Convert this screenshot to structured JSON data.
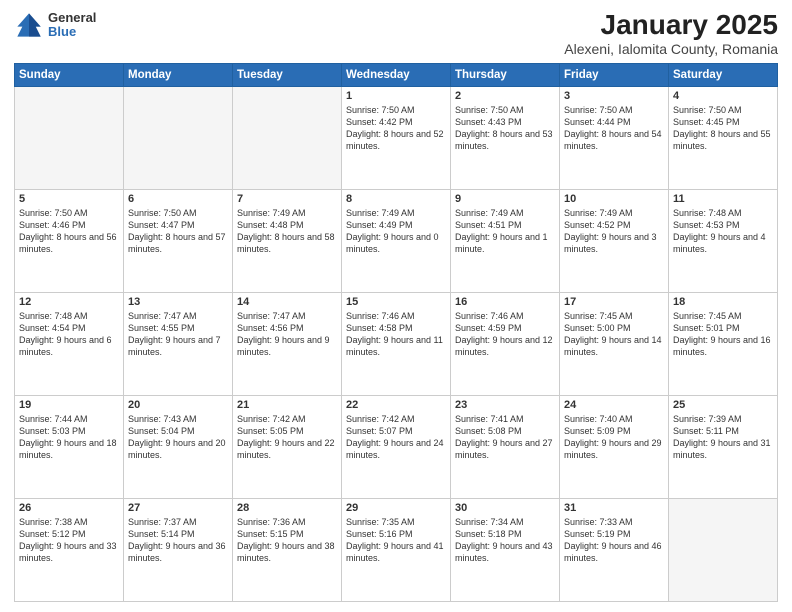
{
  "header": {
    "logo_line1": "General",
    "logo_line2": "Blue",
    "title": "January 2025",
    "subtitle": "Alexeni, Ialomita County, Romania"
  },
  "days_of_week": [
    "Sunday",
    "Monday",
    "Tuesday",
    "Wednesday",
    "Thursday",
    "Friday",
    "Saturday"
  ],
  "weeks": [
    [
      {
        "day": "",
        "info": ""
      },
      {
        "day": "",
        "info": ""
      },
      {
        "day": "",
        "info": ""
      },
      {
        "day": "1",
        "info": "Sunrise: 7:50 AM\nSunset: 4:42 PM\nDaylight: 8 hours\nand 52 minutes."
      },
      {
        "day": "2",
        "info": "Sunrise: 7:50 AM\nSunset: 4:43 PM\nDaylight: 8 hours\nand 53 minutes."
      },
      {
        "day": "3",
        "info": "Sunrise: 7:50 AM\nSunset: 4:44 PM\nDaylight: 8 hours\nand 54 minutes."
      },
      {
        "day": "4",
        "info": "Sunrise: 7:50 AM\nSunset: 4:45 PM\nDaylight: 8 hours\nand 55 minutes."
      }
    ],
    [
      {
        "day": "5",
        "info": "Sunrise: 7:50 AM\nSunset: 4:46 PM\nDaylight: 8 hours\nand 56 minutes."
      },
      {
        "day": "6",
        "info": "Sunrise: 7:50 AM\nSunset: 4:47 PM\nDaylight: 8 hours\nand 57 minutes."
      },
      {
        "day": "7",
        "info": "Sunrise: 7:49 AM\nSunset: 4:48 PM\nDaylight: 8 hours\nand 58 minutes."
      },
      {
        "day": "8",
        "info": "Sunrise: 7:49 AM\nSunset: 4:49 PM\nDaylight: 9 hours\nand 0 minutes."
      },
      {
        "day": "9",
        "info": "Sunrise: 7:49 AM\nSunset: 4:51 PM\nDaylight: 9 hours\nand 1 minute."
      },
      {
        "day": "10",
        "info": "Sunrise: 7:49 AM\nSunset: 4:52 PM\nDaylight: 9 hours\nand 3 minutes."
      },
      {
        "day": "11",
        "info": "Sunrise: 7:48 AM\nSunset: 4:53 PM\nDaylight: 9 hours\nand 4 minutes."
      }
    ],
    [
      {
        "day": "12",
        "info": "Sunrise: 7:48 AM\nSunset: 4:54 PM\nDaylight: 9 hours\nand 6 minutes."
      },
      {
        "day": "13",
        "info": "Sunrise: 7:47 AM\nSunset: 4:55 PM\nDaylight: 9 hours\nand 7 minutes."
      },
      {
        "day": "14",
        "info": "Sunrise: 7:47 AM\nSunset: 4:56 PM\nDaylight: 9 hours\nand 9 minutes."
      },
      {
        "day": "15",
        "info": "Sunrise: 7:46 AM\nSunset: 4:58 PM\nDaylight: 9 hours\nand 11 minutes."
      },
      {
        "day": "16",
        "info": "Sunrise: 7:46 AM\nSunset: 4:59 PM\nDaylight: 9 hours\nand 12 minutes."
      },
      {
        "day": "17",
        "info": "Sunrise: 7:45 AM\nSunset: 5:00 PM\nDaylight: 9 hours\nand 14 minutes."
      },
      {
        "day": "18",
        "info": "Sunrise: 7:45 AM\nSunset: 5:01 PM\nDaylight: 9 hours\nand 16 minutes."
      }
    ],
    [
      {
        "day": "19",
        "info": "Sunrise: 7:44 AM\nSunset: 5:03 PM\nDaylight: 9 hours\nand 18 minutes."
      },
      {
        "day": "20",
        "info": "Sunrise: 7:43 AM\nSunset: 5:04 PM\nDaylight: 9 hours\nand 20 minutes."
      },
      {
        "day": "21",
        "info": "Sunrise: 7:42 AM\nSunset: 5:05 PM\nDaylight: 9 hours\nand 22 minutes."
      },
      {
        "day": "22",
        "info": "Sunrise: 7:42 AM\nSunset: 5:07 PM\nDaylight: 9 hours\nand 24 minutes."
      },
      {
        "day": "23",
        "info": "Sunrise: 7:41 AM\nSunset: 5:08 PM\nDaylight: 9 hours\nand 27 minutes."
      },
      {
        "day": "24",
        "info": "Sunrise: 7:40 AM\nSunset: 5:09 PM\nDaylight: 9 hours\nand 29 minutes."
      },
      {
        "day": "25",
        "info": "Sunrise: 7:39 AM\nSunset: 5:11 PM\nDaylight: 9 hours\nand 31 minutes."
      }
    ],
    [
      {
        "day": "26",
        "info": "Sunrise: 7:38 AM\nSunset: 5:12 PM\nDaylight: 9 hours\nand 33 minutes."
      },
      {
        "day": "27",
        "info": "Sunrise: 7:37 AM\nSunset: 5:14 PM\nDaylight: 9 hours\nand 36 minutes."
      },
      {
        "day": "28",
        "info": "Sunrise: 7:36 AM\nSunset: 5:15 PM\nDaylight: 9 hours\nand 38 minutes."
      },
      {
        "day": "29",
        "info": "Sunrise: 7:35 AM\nSunset: 5:16 PM\nDaylight: 9 hours\nand 41 minutes."
      },
      {
        "day": "30",
        "info": "Sunrise: 7:34 AM\nSunset: 5:18 PM\nDaylight: 9 hours\nand 43 minutes."
      },
      {
        "day": "31",
        "info": "Sunrise: 7:33 AM\nSunset: 5:19 PM\nDaylight: 9 hours\nand 46 minutes."
      },
      {
        "day": "",
        "info": ""
      }
    ]
  ]
}
